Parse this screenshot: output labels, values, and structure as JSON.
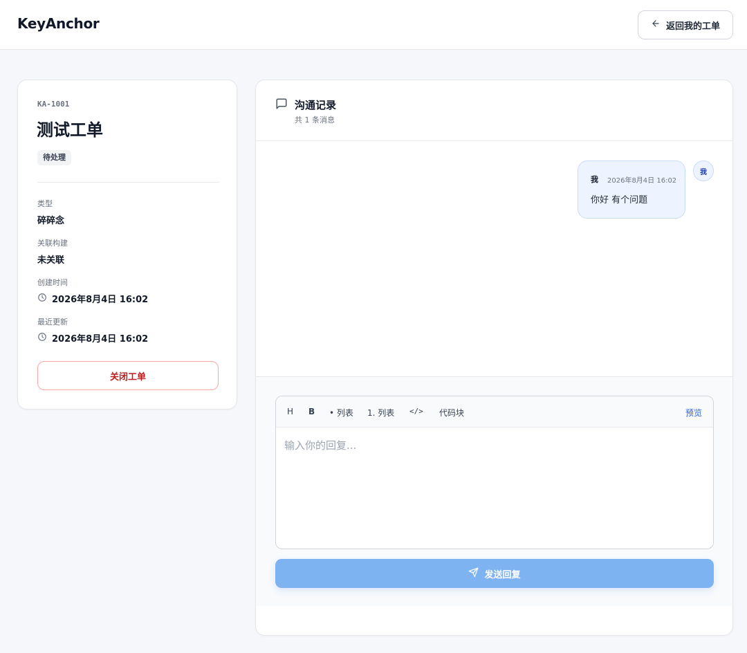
{
  "header": {
    "brand": "KeyAnchor",
    "back_label": "返回我的工单"
  },
  "ticket": {
    "id": "KA-1001",
    "title": "测试工单",
    "status": "待处理",
    "fields": {
      "type_label": "类型",
      "type_value": "碎碎念",
      "build_label": "关联构建",
      "build_value": "未关联",
      "created_label": "创建时间",
      "created_value": "2026年8月4日 16:02",
      "updated_label": "最近更新",
      "updated_value": "2026年8月4日 16:02"
    },
    "close_label": "关闭工单"
  },
  "communication": {
    "title": "沟通记录",
    "count": "共 1 条消息",
    "messages": [
      {
        "author": "我",
        "time": "2026年8月4日 16:02",
        "text": "你好 有个问题",
        "avatar": "我"
      }
    ]
  },
  "composer": {
    "toolbar": {
      "heading": "H",
      "bold": "B",
      "bullet_list": "• 列表",
      "ordered_list": "1. 列表",
      "code": "</>",
      "code_block": "代码块",
      "preview": "预览"
    },
    "placeholder": "输入你的回复...",
    "value": "",
    "send_label": "发送回复"
  },
  "colors": {
    "accent": "#2563eb",
    "send_button": "#7eb3f2",
    "danger": "#b91c1c",
    "bubble_bg": "#eef4ff"
  },
  "icons": {
    "back": "arrow-left-icon",
    "comments": "message-square-icon",
    "clock": "clock-icon",
    "send": "send-icon"
  }
}
